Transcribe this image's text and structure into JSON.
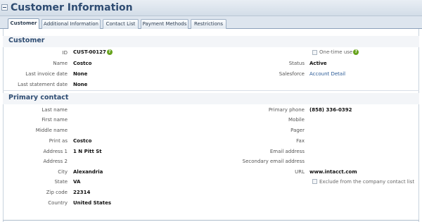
{
  "header": {
    "title": "Customer Information"
  },
  "tabs": [
    {
      "label": "Customer"
    },
    {
      "label": "Additional Information"
    },
    {
      "label": "Contact List"
    },
    {
      "label": "Payment Methods"
    },
    {
      "label": "Restrictions"
    }
  ],
  "customer": {
    "section_title": "Customer",
    "id_label": "ID",
    "id_value": "CUST-00127",
    "help": "?",
    "name_label": "Name",
    "name_value": "Costco",
    "last_invoice_label": "Last invoice date",
    "last_invoice_value": "None",
    "last_statement_label": "Last statement date",
    "last_statement_value": "None",
    "one_time_use_label": "One-time use",
    "status_label": "Status",
    "status_value": "Active",
    "salesforce_label": "Salesforce",
    "salesforce_value": "Account Detail"
  },
  "contact": {
    "section_title": "Primary contact",
    "last_name_label": "Last name",
    "first_name_label": "First name",
    "middle_name_label": "Middle name",
    "print_as_label": "Print as",
    "print_as_value": "Costco",
    "address1_label": "Address 1",
    "address1_value": "1 N Pitt St",
    "address2_label": "Address 2",
    "city_label": "City",
    "city_value": "Alexandria",
    "state_label": "State",
    "state_value": "VA",
    "zip_label": "Zip code",
    "zip_value": "22314",
    "country_label": "Country",
    "country_value": "United States",
    "primary_phone_label": "Primary phone",
    "primary_phone_value": "(858) 336-0392",
    "mobile_label": "Mobile",
    "pager_label": "Pager",
    "fax_label": "Fax",
    "email_label": "Email address",
    "secondary_email_label": "Secondary email address",
    "url_label": "URL",
    "url_value": "www.intacct.com",
    "exclude_label": "Exclude from the company contact list"
  }
}
